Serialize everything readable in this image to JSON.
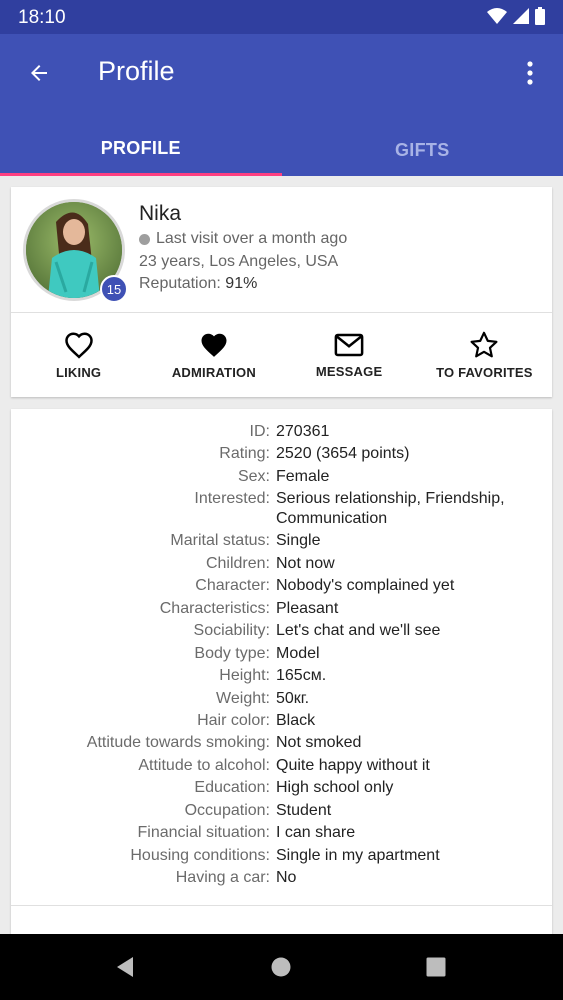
{
  "status_bar": {
    "time": "18:10"
  },
  "app_bar": {
    "title": "Profile"
  },
  "tabs": [
    {
      "label": "PROFILE",
      "active": true
    },
    {
      "label": "GIFTS",
      "active": false
    }
  ],
  "profile": {
    "name": "Nika",
    "last_visit": "Last visit over a month ago",
    "location": "23 years, Los Angeles, USA",
    "reputation_label": "Reputation:",
    "reputation_value": "91%",
    "level": "15"
  },
  "actions": [
    {
      "label": "LIKING",
      "icon": "heart-outline-icon"
    },
    {
      "label": "ADMIRATION",
      "icon": "heart-filled-icon"
    },
    {
      "label": "MESSAGE",
      "icon": "envelope-icon"
    },
    {
      "label": "TO FAVORITES",
      "icon": "star-outline-icon"
    }
  ],
  "info": [
    {
      "key": "ID:",
      "value": "270361"
    },
    {
      "key": "Rating:",
      "value": "2520 (3654 points)"
    },
    {
      "key": "Sex:",
      "value": "Female"
    },
    {
      "key": "Interested:",
      "value": "Serious relationship, Friendship, Communication"
    },
    {
      "key": "Marital status:",
      "value": "Single"
    },
    {
      "key": "Children:",
      "value": "Not now"
    },
    {
      "key": "Character:",
      "value": "Nobody's complained yet"
    },
    {
      "key": "Characteristics:",
      "value": "Pleasant"
    },
    {
      "key": "Sociability:",
      "value": "Let's chat and we'll see"
    },
    {
      "key": "Body type:",
      "value": "Model"
    },
    {
      "key": "Height:",
      "value": "165см."
    },
    {
      "key": "Weight:",
      "value": "50кг."
    },
    {
      "key": "Hair color:",
      "value": "Black"
    },
    {
      "key": "Attitude towards smoking:",
      "value": "Not smoked"
    },
    {
      "key": "Attitude to alcohol:",
      "value": "Quite happy without it"
    },
    {
      "key": "Education:",
      "value": "High school only"
    },
    {
      "key": "Occupation:",
      "value": "Student"
    },
    {
      "key": "Financial situation:",
      "value": "I can share"
    },
    {
      "key": "Housing conditions:",
      "value": "Single in my apartment"
    },
    {
      "key": "Having a car:",
      "value": "No"
    }
  ],
  "colors": {
    "primary": "#3f51b5",
    "primary_dark": "#303f9f",
    "accent": "#ff4081"
  }
}
